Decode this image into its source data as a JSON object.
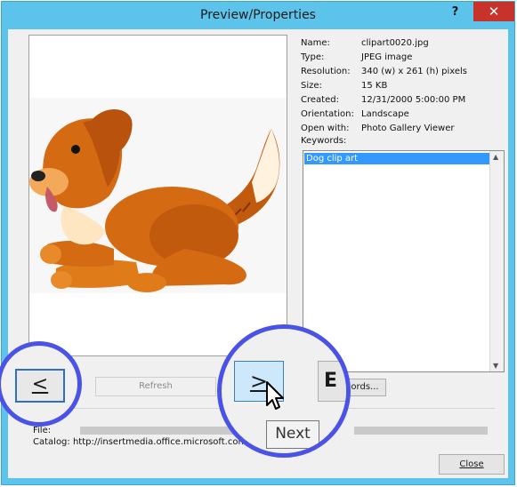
{
  "window": {
    "title": "Preview/Properties",
    "help_label": "?",
    "close_label": "✕"
  },
  "properties": [
    {
      "label": "Name:",
      "value": "clipart0020.jpg"
    },
    {
      "label": "Type:",
      "value": "JPEG image"
    },
    {
      "label": "Resolution:",
      "value": "340 (w) x 261 (h) pixels"
    },
    {
      "label": "Size:",
      "value": "15 KB"
    },
    {
      "label": "Created:",
      "value": "12/31/2000 5:00:00 PM"
    },
    {
      "label": "Orientation:",
      "value": "Landscape"
    },
    {
      "label": "Open with:",
      "value": "Photo Gallery Viewer"
    }
  ],
  "keywords": {
    "label": "Keywords:",
    "items": [
      "Dog clip art"
    ]
  },
  "buttons": {
    "prev": "<",
    "refresh": "Refresh",
    "next": ">",
    "edit_keywords_short": "E",
    "edit_keywords_tail": "ords...",
    "close": "Close"
  },
  "footer": {
    "file_label": "File:",
    "catalog_label": "Catalog:",
    "catalog_value": "http://insertmedia.office.microsoft.com"
  },
  "tooltip": "Next",
  "colors": {
    "titlebar": "#5cc4ea",
    "close": "#c7322b",
    "highlight_circle": "#4b52e6",
    "selection": "#3399ff"
  }
}
